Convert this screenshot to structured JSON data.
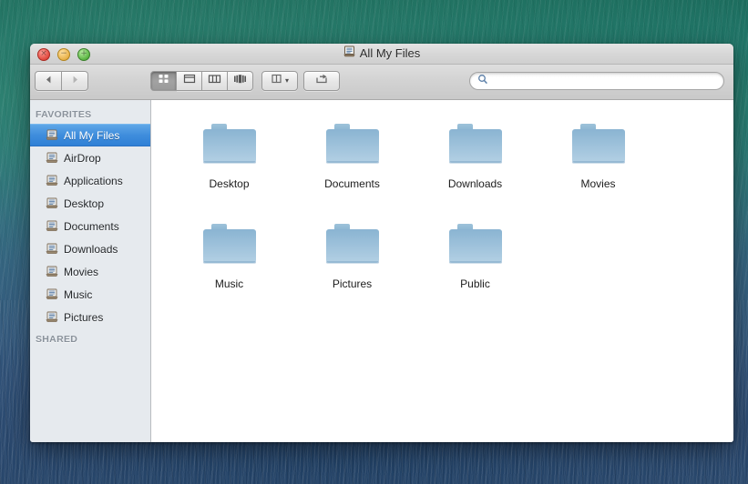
{
  "window": {
    "title": "All My Files",
    "title_icon": "all-my-files-icon",
    "controls": {
      "close_label": "×",
      "minimize_label": "−",
      "maximize_label": "+"
    }
  },
  "toolbar": {
    "back_icon": "back-arrow-icon",
    "forward_icon": "forward-arrow-icon",
    "view_modes": [
      {
        "name": "icon-view",
        "icon": "grid-icon",
        "selected": true
      },
      {
        "name": "list-view",
        "icon": "list-icon",
        "selected": false
      },
      {
        "name": "column-view",
        "icon": "columns-icon",
        "selected": false
      },
      {
        "name": "coverflow-view",
        "icon": "coverflow-icon",
        "selected": false
      }
    ],
    "arrange_icon": "arrange-icon",
    "arrange_caret": "▾",
    "share_icon": "share-icon"
  },
  "search": {
    "value": "",
    "placeholder": "",
    "icon": "search-icon"
  },
  "sidebar": {
    "sections": [
      {
        "header": "FAVORITES",
        "items": [
          {
            "label": "All My Files",
            "icon": "document-icon",
            "selected": true
          },
          {
            "label": "AirDrop",
            "icon": "document-icon",
            "selected": false
          },
          {
            "label": "Applications",
            "icon": "document-icon",
            "selected": false
          },
          {
            "label": "Desktop",
            "icon": "document-icon",
            "selected": false
          },
          {
            "label": "Documents",
            "icon": "document-icon",
            "selected": false
          },
          {
            "label": "Downloads",
            "icon": "document-icon",
            "selected": false
          },
          {
            "label": "Movies",
            "icon": "document-icon",
            "selected": false
          },
          {
            "label": "Music",
            "icon": "document-icon",
            "selected": false
          },
          {
            "label": "Pictures",
            "icon": "document-icon",
            "selected": false
          }
        ]
      },
      {
        "header": "SHARED",
        "items": []
      }
    ]
  },
  "content": {
    "files": [
      {
        "name": "Desktop",
        "icon": "folder-icon"
      },
      {
        "name": "Documents",
        "icon": "folder-icon"
      },
      {
        "name": "Downloads",
        "icon": "folder-icon"
      },
      {
        "name": "Movies",
        "icon": "folder-icon"
      },
      {
        "name": "Music",
        "icon": "folder-icon"
      },
      {
        "name": "Pictures",
        "icon": "folder-icon"
      },
      {
        "name": "Public",
        "icon": "folder-icon"
      }
    ]
  },
  "colors": {
    "folder_blue": "#8fb8d4",
    "selection_blue": "#3f8ddc",
    "sidebar_bg": "#e6eaee",
    "desktop_top": "#2c7f72",
    "desktop_bottom": "#2c4a6f"
  }
}
